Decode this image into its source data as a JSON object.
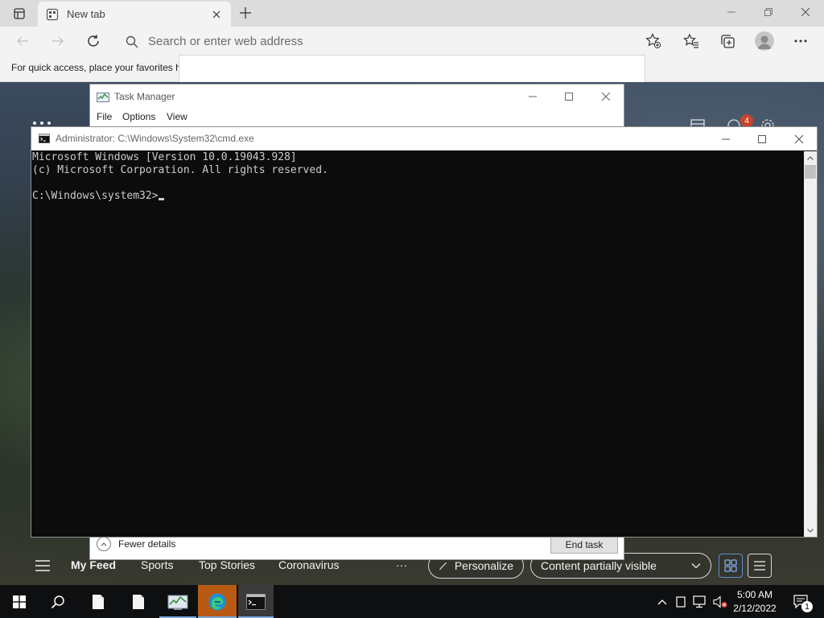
{
  "browser": {
    "tab": {
      "title": "New tab"
    },
    "address_bar": {
      "placeholder": "Search or enter web address"
    },
    "favorites_bar": {
      "text": "For quick access, place your favorites h"
    }
  },
  "new_tab_page": {
    "nav": {
      "my_feed": "My Feed",
      "sports": "Sports",
      "top_stories": "Top Stories",
      "coronavirus": "Coronavirus",
      "more": "···"
    },
    "personalize_label": "Personalize",
    "visibility_select": "Content partially visible",
    "notification_count": "4"
  },
  "task_manager": {
    "title": "Task Manager",
    "menu": [
      "File",
      "Options",
      "View"
    ],
    "fewer_details": "Fewer details",
    "end_task": "End task"
  },
  "cmd": {
    "title": "Administrator: C:\\Windows\\System32\\cmd.exe",
    "lines": [
      "Microsoft Windows [Version 10.0.19043.928]",
      "(c) Microsoft Corporation. All rights reserved."
    ],
    "prompt": "C:\\Windows\\system32>"
  },
  "taskbar": {
    "time": "5:00 AM",
    "date": "2/12/2022",
    "notification_count": "1"
  },
  "colors": {
    "console_bg": "#0c0c0c",
    "console_text": "#cccccc",
    "taskbar_bg": "#0e0f10",
    "taskbar_accent": "#78a9de",
    "badge": "#c8452a"
  }
}
